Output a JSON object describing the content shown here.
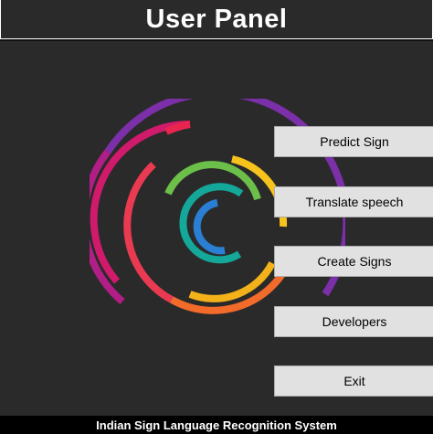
{
  "window": {
    "title": "User Panel",
    "footer": "Indian Sign Language Recognition System"
  },
  "menu": {
    "predict_label": "Predict Sign",
    "translate_label": "Translate speech",
    "create_label": "Create Signs",
    "developers_label": "Developers",
    "exit_label": "Exit"
  },
  "colors": {
    "background": "#2a2a2a",
    "title_text": "#ffffff",
    "button_face": "#e1e1e1",
    "footer_background": "#000000",
    "logo_purple": "#7b2fa8",
    "logo_magenta": "#c2187a",
    "logo_red": "#e8254e",
    "logo_orange": "#f26b2a",
    "logo_yellow": "#f6c21c",
    "logo_green": "#6cc04a",
    "logo_teal": "#14a89a",
    "logo_blue": "#2a7fd4"
  },
  "icons": {
    "logo": "concentric-rainbow-arcs-logo"
  }
}
